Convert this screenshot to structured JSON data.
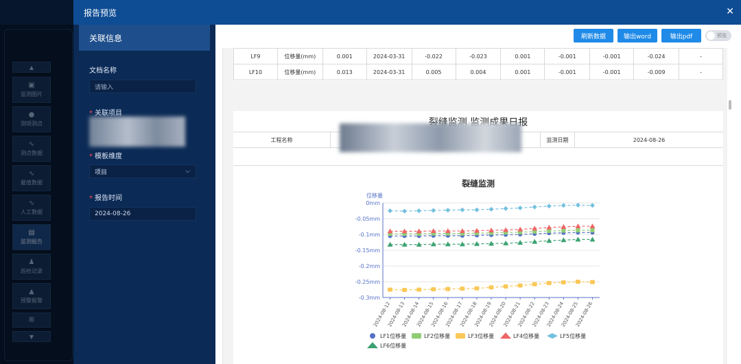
{
  "background_nav": {
    "items": [
      {
        "label": "监测图片",
        "icon": "image-icon"
      },
      {
        "label": "测项测点",
        "icon": "chat-icon"
      },
      {
        "label": "测点数据",
        "icon": "pulse-icon"
      },
      {
        "label": "最值数据",
        "icon": "pulse-icon"
      },
      {
        "label": "人工数据",
        "icon": "pulse-icon"
      },
      {
        "label": "监测报告",
        "icon": "clipboard-icon"
      },
      {
        "label": "巡检记录",
        "icon": "user-check-icon"
      },
      {
        "label": "预警报警",
        "icon": "alarm-icon"
      }
    ]
  },
  "modal": {
    "title": "报告预览",
    "left_title": "关联信息",
    "doc_name_label": "文档名称",
    "doc_name_placeholder": "请输入",
    "project_label": "关联项目",
    "template_label": "模板维度",
    "template_value": "项目",
    "report_time_label": "报告时间",
    "report_time_value": "2024-08-26",
    "toolbar": {
      "refresh": "刷新数据",
      "word": "输出word",
      "pdf": "输出pdf",
      "preview_toggle": "预览"
    }
  },
  "data_table": {
    "rows": [
      [
        "LF9",
        "位移量(mm)",
        "0.001",
        "2024-03-31",
        "-0.022",
        "-0.023",
        "0.001",
        "-0.001",
        "-0.001",
        "-0.024",
        "-"
      ],
      [
        "LF10",
        "位移量(mm)",
        "0.013",
        "2024-03-31",
        "0.005",
        "0.004",
        "0.001",
        "-0.001",
        "-0.001",
        "-0.009",
        "-"
      ]
    ]
  },
  "report": {
    "title": "裂缝监测 监测成果日报",
    "project_name_label": "工程名称",
    "monitor_date_label": "监测日期",
    "monitor_date_value": "2024-08-26"
  },
  "chart_data": {
    "type": "line",
    "title": "裂缝监测",
    "ylabel": "位移量",
    "xlabel": "",
    "ylim": [
      -0.3,
      0
    ],
    "yticks": [
      "0mm",
      "-0.05mm",
      "-0.1mm",
      "-0.15mm",
      "-0.2mm",
      "-0.25mm",
      "-0.3mm"
    ],
    "grid": true,
    "legend": "bottom",
    "x": [
      "2024-08-12",
      "2024-08-13",
      "2024-08-14",
      "2024-08-15",
      "2024-08-16",
      "2024-08-17",
      "2024-08-18",
      "2024-08-19",
      "2024-08-20",
      "2024-08-21",
      "2024-08-22",
      "2024-08-23",
      "2024-08-24",
      "2024-08-25",
      "2024-08-26"
    ],
    "series": [
      {
        "name": "LF1位移量",
        "color": "#5470c6",
        "marker": "circle",
        "values": [
          -0.105,
          -0.105,
          -0.105,
          -0.104,
          -0.104,
          -0.104,
          -0.103,
          -0.102,
          -0.101,
          -0.1,
          -0.098,
          -0.096,
          -0.095,
          -0.094,
          -0.094
        ]
      },
      {
        "name": "LF2位移量",
        "color": "#91cc75",
        "marker": "rect",
        "values": [
          -0.098,
          -0.098,
          -0.098,
          -0.097,
          -0.097,
          -0.097,
          -0.096,
          -0.095,
          -0.094,
          -0.093,
          -0.091,
          -0.089,
          -0.088,
          -0.087,
          -0.087
        ]
      },
      {
        "name": "LF3位移量",
        "color": "#fac858",
        "marker": "roundrect",
        "values": [
          -0.275,
          -0.276,
          -0.275,
          -0.274,
          -0.273,
          -0.272,
          -0.271,
          -0.268,
          -0.265,
          -0.262,
          -0.258,
          -0.254,
          -0.252,
          -0.25,
          -0.251
        ]
      },
      {
        "name": "LF4位移量",
        "color": "#ee6666",
        "marker": "triangle",
        "values": [
          -0.09,
          -0.09,
          -0.09,
          -0.089,
          -0.089,
          -0.089,
          -0.088,
          -0.087,
          -0.086,
          -0.084,
          -0.081,
          -0.078,
          -0.076,
          -0.074,
          -0.074
        ]
      },
      {
        "name": "LF5位移量",
        "color": "#73c0de",
        "marker": "diamond",
        "values": [
          -0.025,
          -0.026,
          -0.025,
          -0.024,
          -0.023,
          -0.022,
          -0.022,
          -0.02,
          -0.018,
          -0.016,
          -0.013,
          -0.01,
          -0.008,
          -0.007,
          -0.008
        ]
      },
      {
        "name": "LF6位移量",
        "color": "#3ba272",
        "marker": "triangle",
        "values": [
          -0.132,
          -0.132,
          -0.132,
          -0.131,
          -0.131,
          -0.131,
          -0.13,
          -0.129,
          -0.128,
          -0.126,
          -0.123,
          -0.12,
          -0.118,
          -0.116,
          -0.116
        ]
      }
    ]
  }
}
